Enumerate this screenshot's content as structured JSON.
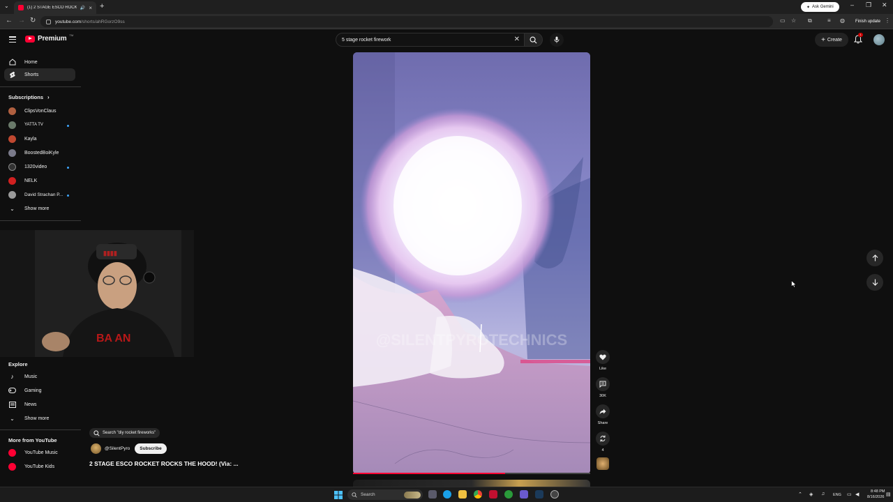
{
  "browser": {
    "tab_title": "(1) 2 STAGE ESCO ROCKET F",
    "gemini_label": "Ask Gemini",
    "url_host": "youtube.com",
    "url_path": "/shorts/ahRGorzO9ss",
    "finish_update_label": "Finish update"
  },
  "header": {
    "logo_text": "Premium",
    "logo_tm": "TM",
    "search_value": "5 stage rocket firework",
    "create_label": "Create",
    "notification_count": "1"
  },
  "sidebar": {
    "main": [
      {
        "label": "Home",
        "icon": "home-icon"
      },
      {
        "label": "Shorts",
        "icon": "shorts-icon",
        "active": true
      }
    ],
    "subscriptions_heading": "Subscriptions",
    "subscriptions": [
      {
        "label": "ClipsVonClaus",
        "color": "#b06040",
        "new": false
      },
      {
        "label": "YATTA TV",
        "color": "#6a7a6a",
        "new": true
      },
      {
        "label": "Kayla",
        "color": "#c04830",
        "new": false
      },
      {
        "label": "BoostedBoiKyle",
        "color": "#7a7a8a",
        "new": false
      },
      {
        "label": "1320video",
        "color": "#333333",
        "new": true
      },
      {
        "label": "NELK",
        "color": "#d02020",
        "new": false
      },
      {
        "label": "David Strachan P...",
        "color": "#9a9a9a",
        "new": true
      }
    ],
    "show_more": "Show more",
    "explore_heading": "Explore",
    "explore": [
      {
        "label": "Music",
        "icon": "music-icon"
      },
      {
        "label": "Gaming",
        "icon": "gaming-icon"
      },
      {
        "label": "News",
        "icon": "news-icon"
      }
    ],
    "explore_show_more": "Show more",
    "more_heading": "More from YouTube",
    "more": [
      {
        "label": "YouTube Music",
        "color": "#ff0033"
      },
      {
        "label": "YouTube Kids",
        "color": "#ff0033"
      }
    ]
  },
  "short": {
    "search_chip": "Search \"diy rocket fireworks\"",
    "channel": "@SilentPyro",
    "subscribe_label": "Subscribe",
    "title": "2 STAGE ESCO ROCKET ROCKS THE HOOD! (Via: ...",
    "watermark": "@SILENTPYROTECHNICS",
    "progress": 0.64,
    "like_label": "Like",
    "comments_count": "30K",
    "share_label": "Share",
    "remix_count": "4"
  },
  "taskbar": {
    "search_placeholder": "Search",
    "lang": "ENG",
    "time": "8:48 PM",
    "date": "8/16/2026"
  },
  "colors": {
    "background": "#0f0f0f",
    "accent_red": "#ff0033",
    "new_dot": "#3ea6ff"
  }
}
